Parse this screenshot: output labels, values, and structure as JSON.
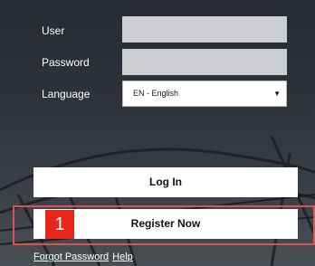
{
  "form": {
    "user_label": "User",
    "user_value": "",
    "password_label": "Password",
    "password_value": "",
    "language_label": "Language",
    "language_selected": "EN - English"
  },
  "buttons": {
    "login_label": "Log In",
    "register_label": "Register Now"
  },
  "annotation": {
    "badge_number": "1",
    "highlight_color": "#d9534f"
  },
  "links": {
    "forgot_password": "Forgot Password",
    "help": "Help"
  }
}
